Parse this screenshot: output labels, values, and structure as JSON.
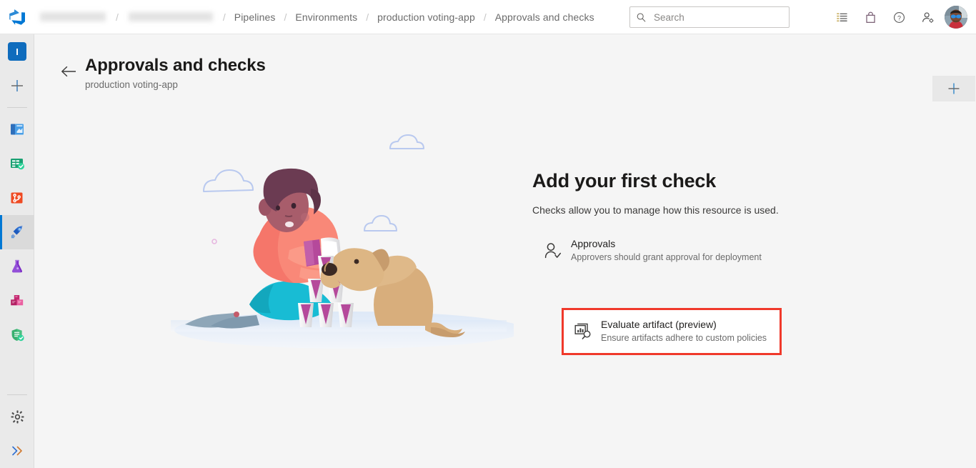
{
  "header": {
    "logo_icon": "azure-devops-logo",
    "breadcrumb": [
      {
        "label": "",
        "redacted": true,
        "name": "organization"
      },
      {
        "label": "",
        "redacted": true,
        "name": "project"
      },
      {
        "label": "Pipelines",
        "redacted": false,
        "name": "pipelines"
      },
      {
        "label": "Environments",
        "redacted": false,
        "name": "environments"
      },
      {
        "label": "production voting-app",
        "redacted": false,
        "name": "environment"
      },
      {
        "label": "Approvals and checks",
        "redacted": false,
        "name": "approvals-and-checks"
      }
    ],
    "separator": "/",
    "search": {
      "placeholder": "Search",
      "value": "",
      "icon": "search-icon"
    },
    "icons": [
      {
        "name": "task-list-icon",
        "label": "Work items"
      },
      {
        "name": "marketplace-bag-icon",
        "label": "Marketplace"
      },
      {
        "name": "help-question-icon",
        "label": "Help"
      },
      {
        "name": "user-settings-icon",
        "label": "User settings"
      }
    ],
    "avatar_name": "user-avatar"
  },
  "sidebar": {
    "project_initial": "I",
    "items": [
      {
        "name": "project-avatar",
        "label": "I"
      },
      {
        "name": "new-item",
        "label": "+"
      },
      {
        "name": "overview",
        "label": "Overview"
      },
      {
        "name": "boards",
        "label": "Boards"
      },
      {
        "name": "repos",
        "label": "Repos"
      },
      {
        "name": "pipelines",
        "label": "Pipelines",
        "selected": true
      },
      {
        "name": "test-plans",
        "label": "Test Plans"
      },
      {
        "name": "artifacts",
        "label": "Artifacts"
      },
      {
        "name": "advanced-security",
        "label": "Advanced Security"
      }
    ],
    "bottom_items": [
      {
        "name": "project-settings",
        "label": "Project settings"
      },
      {
        "name": "expand-rail",
        "label": "Expand"
      }
    ]
  },
  "page": {
    "back_label": "Back",
    "title": "Approvals and checks",
    "subtitle": "production voting-app",
    "add_button_label": "+"
  },
  "zero_state": {
    "title": "Add your first check",
    "subtitle": "Checks allow you to manage how this resource is used.",
    "checks": [
      {
        "name": "Approvals",
        "description": "Approvers should grant approval for deployment",
        "icon": "person-check-icon",
        "highlighted": false
      },
      {
        "name": "Evaluate artifact (preview)",
        "description": "Ensure artifacts adhere to custom policies",
        "icon": "artifact-evaluate-icon",
        "highlighted": true
      }
    ]
  },
  "colors": {
    "accent": "#0078d4",
    "highlight_red": "#f0392b",
    "rail_bg": "#eaeaea",
    "canvas_bg": "#f5f5f5",
    "header_bg": "#ffffff",
    "muted_text": "#6b6b6b"
  }
}
